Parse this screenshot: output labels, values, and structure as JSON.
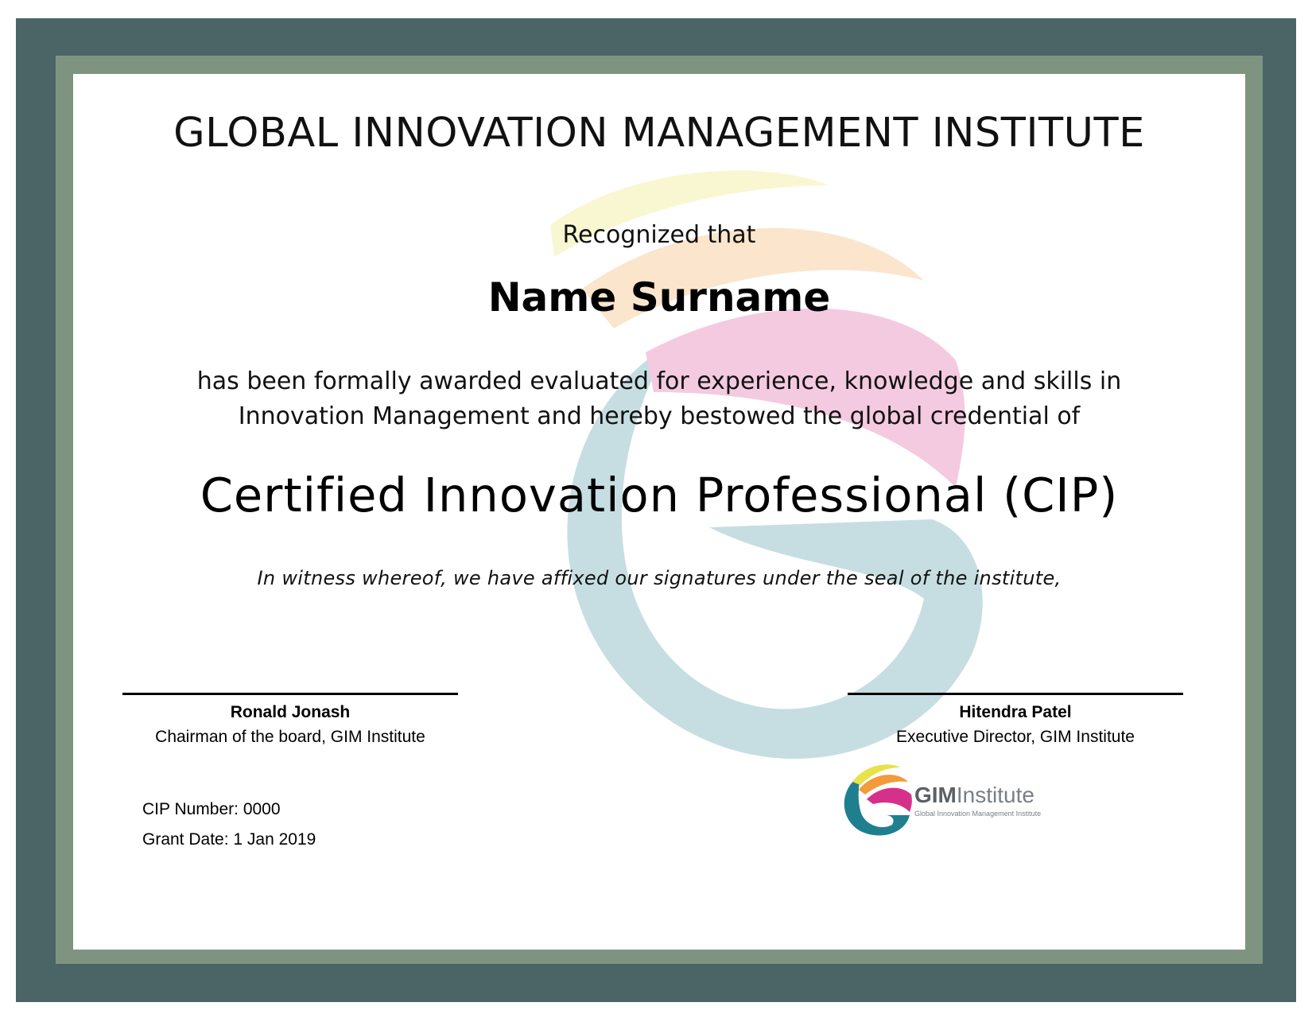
{
  "certificate": {
    "institute_title": "GLOBAL INNOVATION MANAGEMENT INSTITUTE",
    "recognized_text": "Recognized that",
    "recipient_name": "Name Surname",
    "award_line_1": "has been formally awarded evaluated for experience, knowledge and skills in",
    "award_line_2": "Innovation Management and hereby bestowed the global credential of",
    "credential": "Certified Innovation Professional (CIP)",
    "witness_text": "In witness whereof, we have affixed our signatures under the seal of the institute,"
  },
  "signatories": [
    {
      "name": "Ronald Jonash",
      "role": "Chairman of the board, GIM Institute"
    },
    {
      "name": "Hitendra Patel",
      "role": "Executive Director, GIM Institute"
    }
  ],
  "details": {
    "cip_number": "CIP Number: 0000",
    "grant_date": "Grant Date: 1 Jan 2019"
  },
  "logo": {
    "text_bold": "GIM",
    "text_light": "Institute",
    "subtitle": "Global Innovation Management Institute"
  },
  "colors": {
    "outer_frame": "#4b6566",
    "inner_frame": "#7f9480",
    "logo_teal": "#1f7f8f",
    "logo_pink": "#d6318a",
    "logo_orange": "#f39a3a",
    "logo_yellow": "#e7e24a"
  }
}
